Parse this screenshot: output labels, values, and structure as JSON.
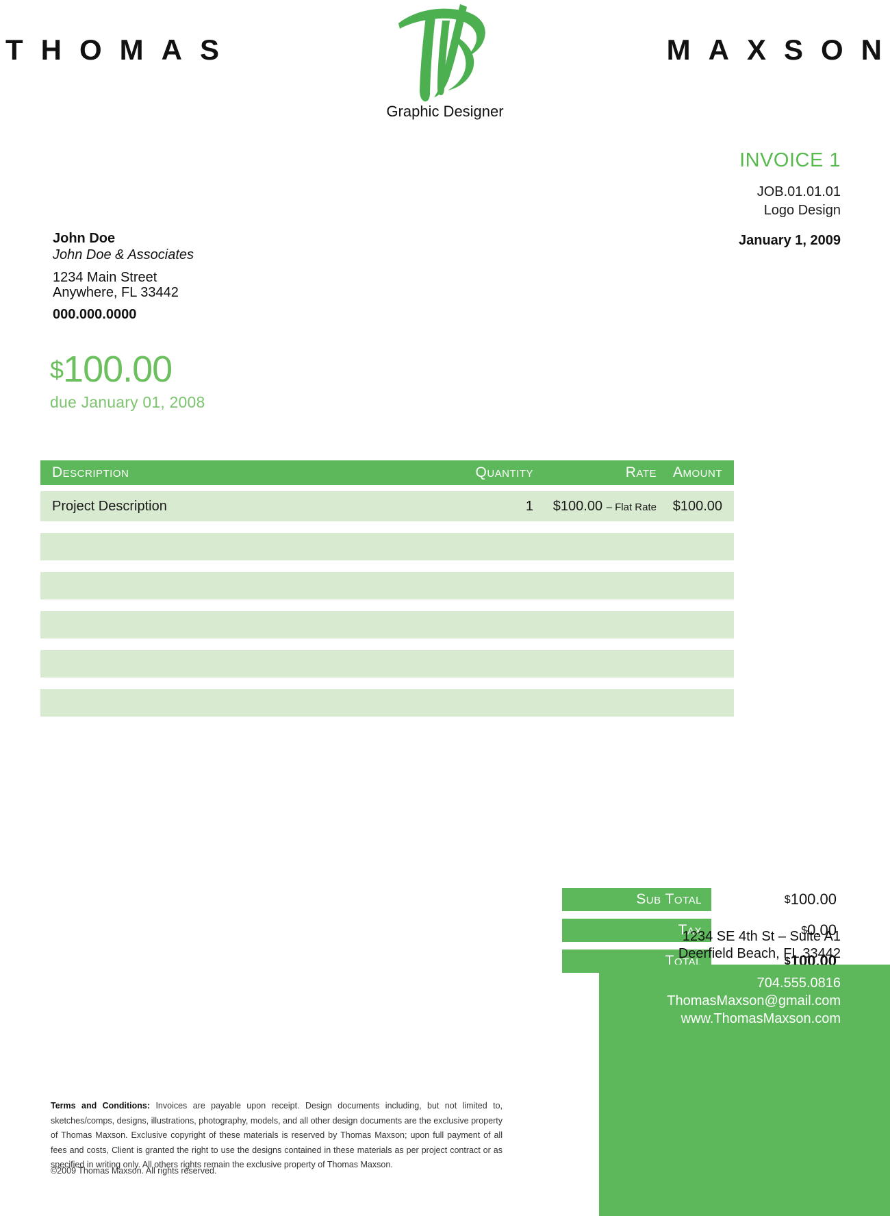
{
  "brand": {
    "name_left": "THOMAS",
    "name_right": "MAXSON",
    "tagline": "Graphic Designer",
    "accent_color": "#5cb85a",
    "accent_light": "#d8ead0",
    "amount_color": "#6cbf5e"
  },
  "invoice": {
    "title": "INVOICE 1",
    "job_number": "JOB.01.01.01",
    "job_name": "Logo Design",
    "date": "January 1, 2009"
  },
  "client": {
    "name": "John Doe",
    "company": "John Doe & Associates",
    "address_line1": "1234 Main Street",
    "address_line2": "Anywhere, FL 33442",
    "phone": "000.000.0000"
  },
  "amount_due": {
    "currency_symbol": "$",
    "amount": "100.00",
    "due_text": "due January 01, 2008"
  },
  "table": {
    "headers": {
      "description": "Description",
      "quantity": "Quantity",
      "rate": "Rate",
      "amount": "Amount"
    },
    "rows": [
      {
        "description": "Project Description",
        "quantity": "1",
        "rate_value": "$100.00",
        "rate_note": "– Flat Rate",
        "amount": "$100.00"
      }
    ],
    "empty_row_count": 5
  },
  "totals": {
    "sub_total_label": "Sub Total",
    "sub_total_currency": "$",
    "sub_total_value": "100.00",
    "tax_label": "Tax",
    "tax_currency": "$",
    "tax_value": "0.00",
    "total_label": "Total",
    "total_currency": "$",
    "total_value": "100.00"
  },
  "contact": {
    "address_line1": "1234 SE 4th St – Suite A1",
    "address_line2": "Deerfield Beach, FL 33442",
    "phone": "704.555.0816",
    "email": "ThomasMaxson@gmail.com",
    "website": "www.ThomasMaxson.com"
  },
  "terms": {
    "heading": "Terms and Conditions:",
    "body": "Invoices are payable upon receipt. Design documents including, but not limited to, sketches/comps, designs, illustrations, photography, models, and all other design documents are the exclusive property of Thomas Maxson. Exclusive copyright of these materials is reserved by Thomas Maxson; upon full payment of all fees and costs, Client is granted the right to use the designs contained in these materials as per project contract or as specified in writing only. All others rights remain the exclusive property of Thomas Maxson.",
    "copyright": "©2009 Thomas Maxson. All rights reserved."
  }
}
